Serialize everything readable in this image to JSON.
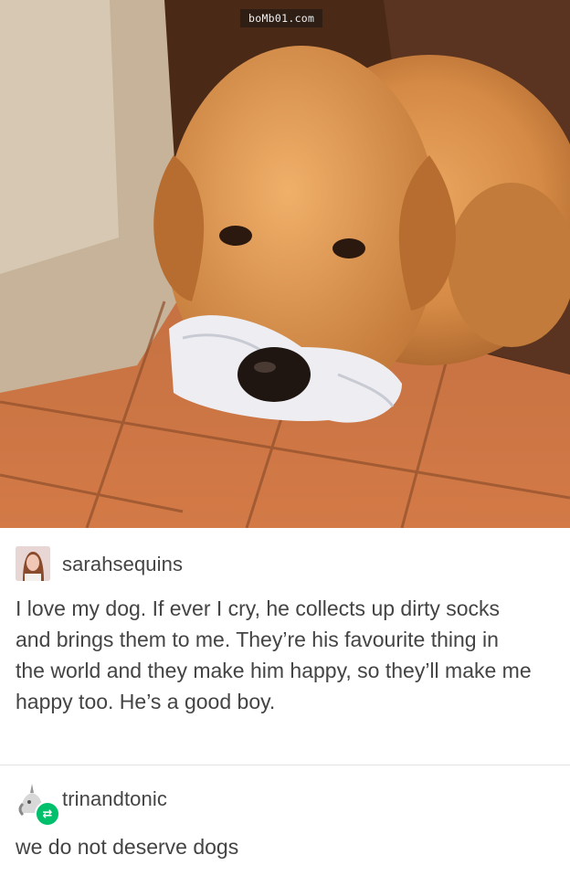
{
  "watermark": "boMb01.com",
  "photo": {
    "subject": "dog-with-sock-icon"
  },
  "posts": [
    {
      "username": "sarahsequins",
      "text": "I love my dog. If ever I cry, he collects up dirty socks and brings them to me. They’re his favourite thing in the world and they make him happy, so they’ll make me happy too. He’s a good boy."
    },
    {
      "username": "trinandtonic",
      "text": "we do not deserve dogs"
    }
  ],
  "colors": {
    "reblog_badge": "#00c06c",
    "text": "#444444",
    "divider": "#e3e3e3"
  }
}
